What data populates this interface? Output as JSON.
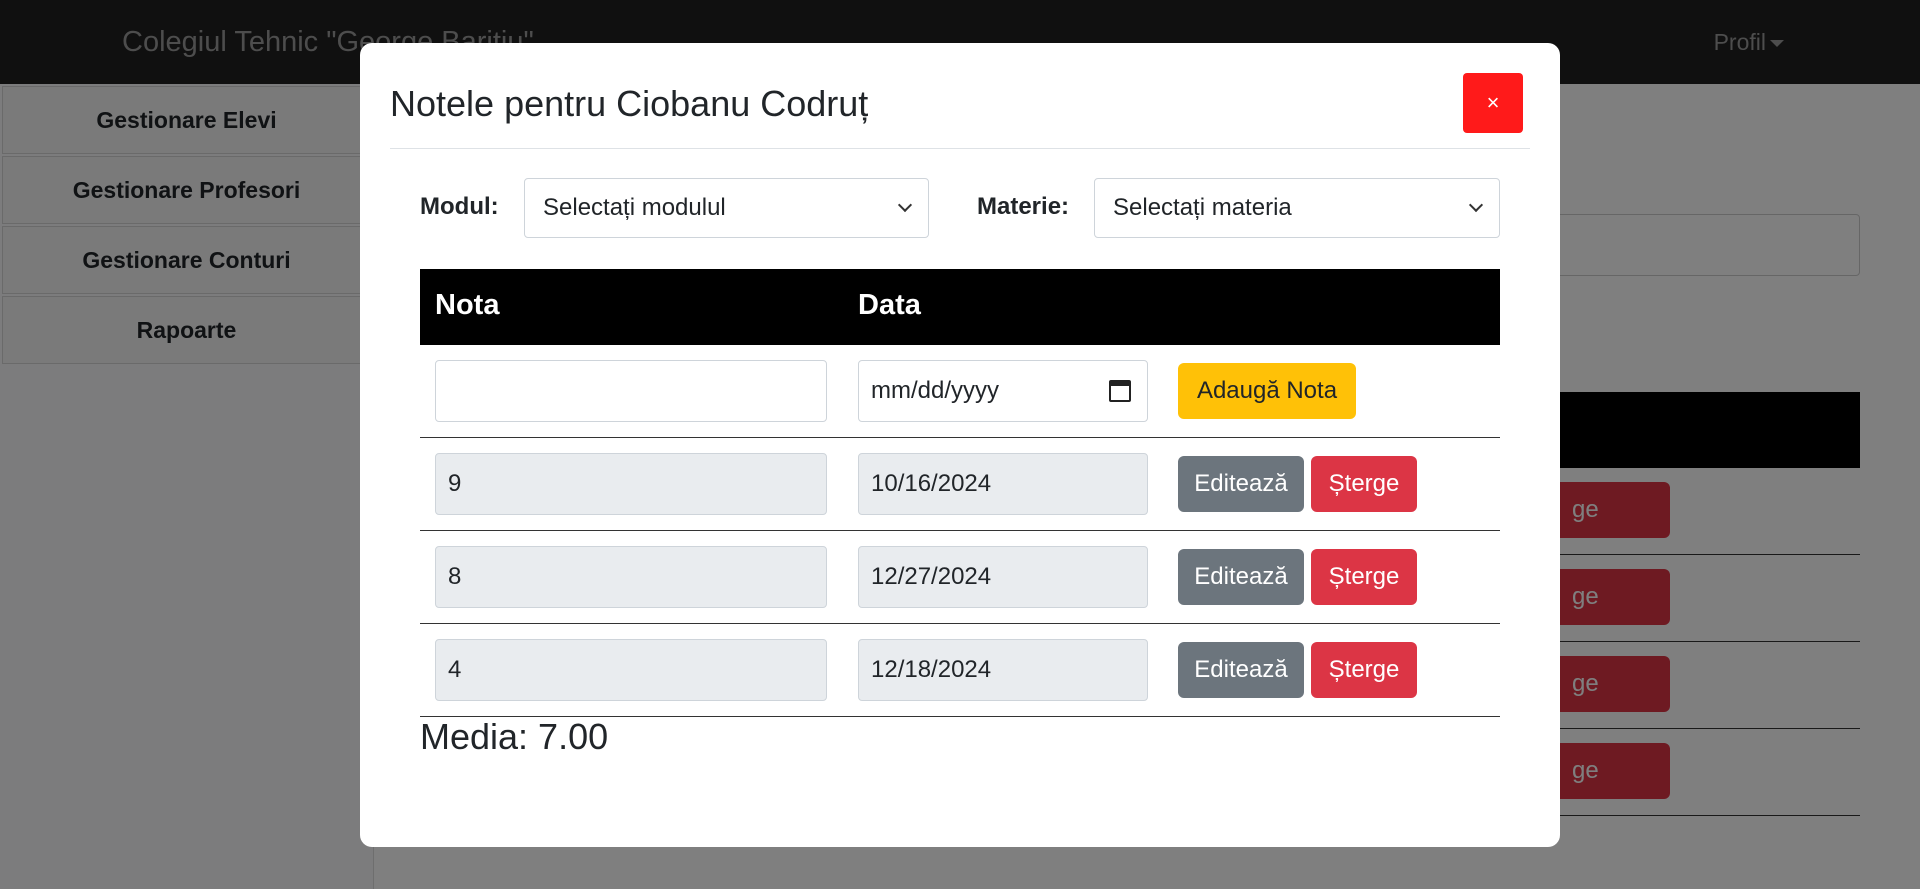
{
  "app": {
    "brand": "Colegiul Tehnic \"George Baritiu\"",
    "profile_label": "Profil"
  },
  "sidebar": {
    "items": [
      {
        "label": "Gestionare Elevi"
      },
      {
        "label": "Gestionare Profesori"
      },
      {
        "label": "Gestionare Conturi"
      },
      {
        "label": "Rapoarte"
      }
    ]
  },
  "background": {
    "delete_label_partial": "ge"
  },
  "modal": {
    "title": "Notele pentru Ciobanu Codruț",
    "close_label": "×",
    "module_label": "Modul:",
    "module_value": "Selectați modulul",
    "subject_label": "Materie:",
    "subject_value": "Selectați materia",
    "columns": [
      "Nota",
      "Data"
    ],
    "new_grade": {
      "value": "",
      "date_placeholder": "mm/dd/yyyy",
      "add_label": "Adaugă Nota"
    },
    "rows": [
      {
        "grade": "9",
        "date": "10/16/2024",
        "edit_label": "Editează",
        "delete_label": "Șterge"
      },
      {
        "grade": "8",
        "date": "12/27/2024",
        "edit_label": "Editează",
        "delete_label": "Șterge"
      },
      {
        "grade": "4",
        "date": "12/18/2024",
        "edit_label": "Editează",
        "delete_label": "Șterge"
      }
    ],
    "average": "Media: 7.00"
  }
}
